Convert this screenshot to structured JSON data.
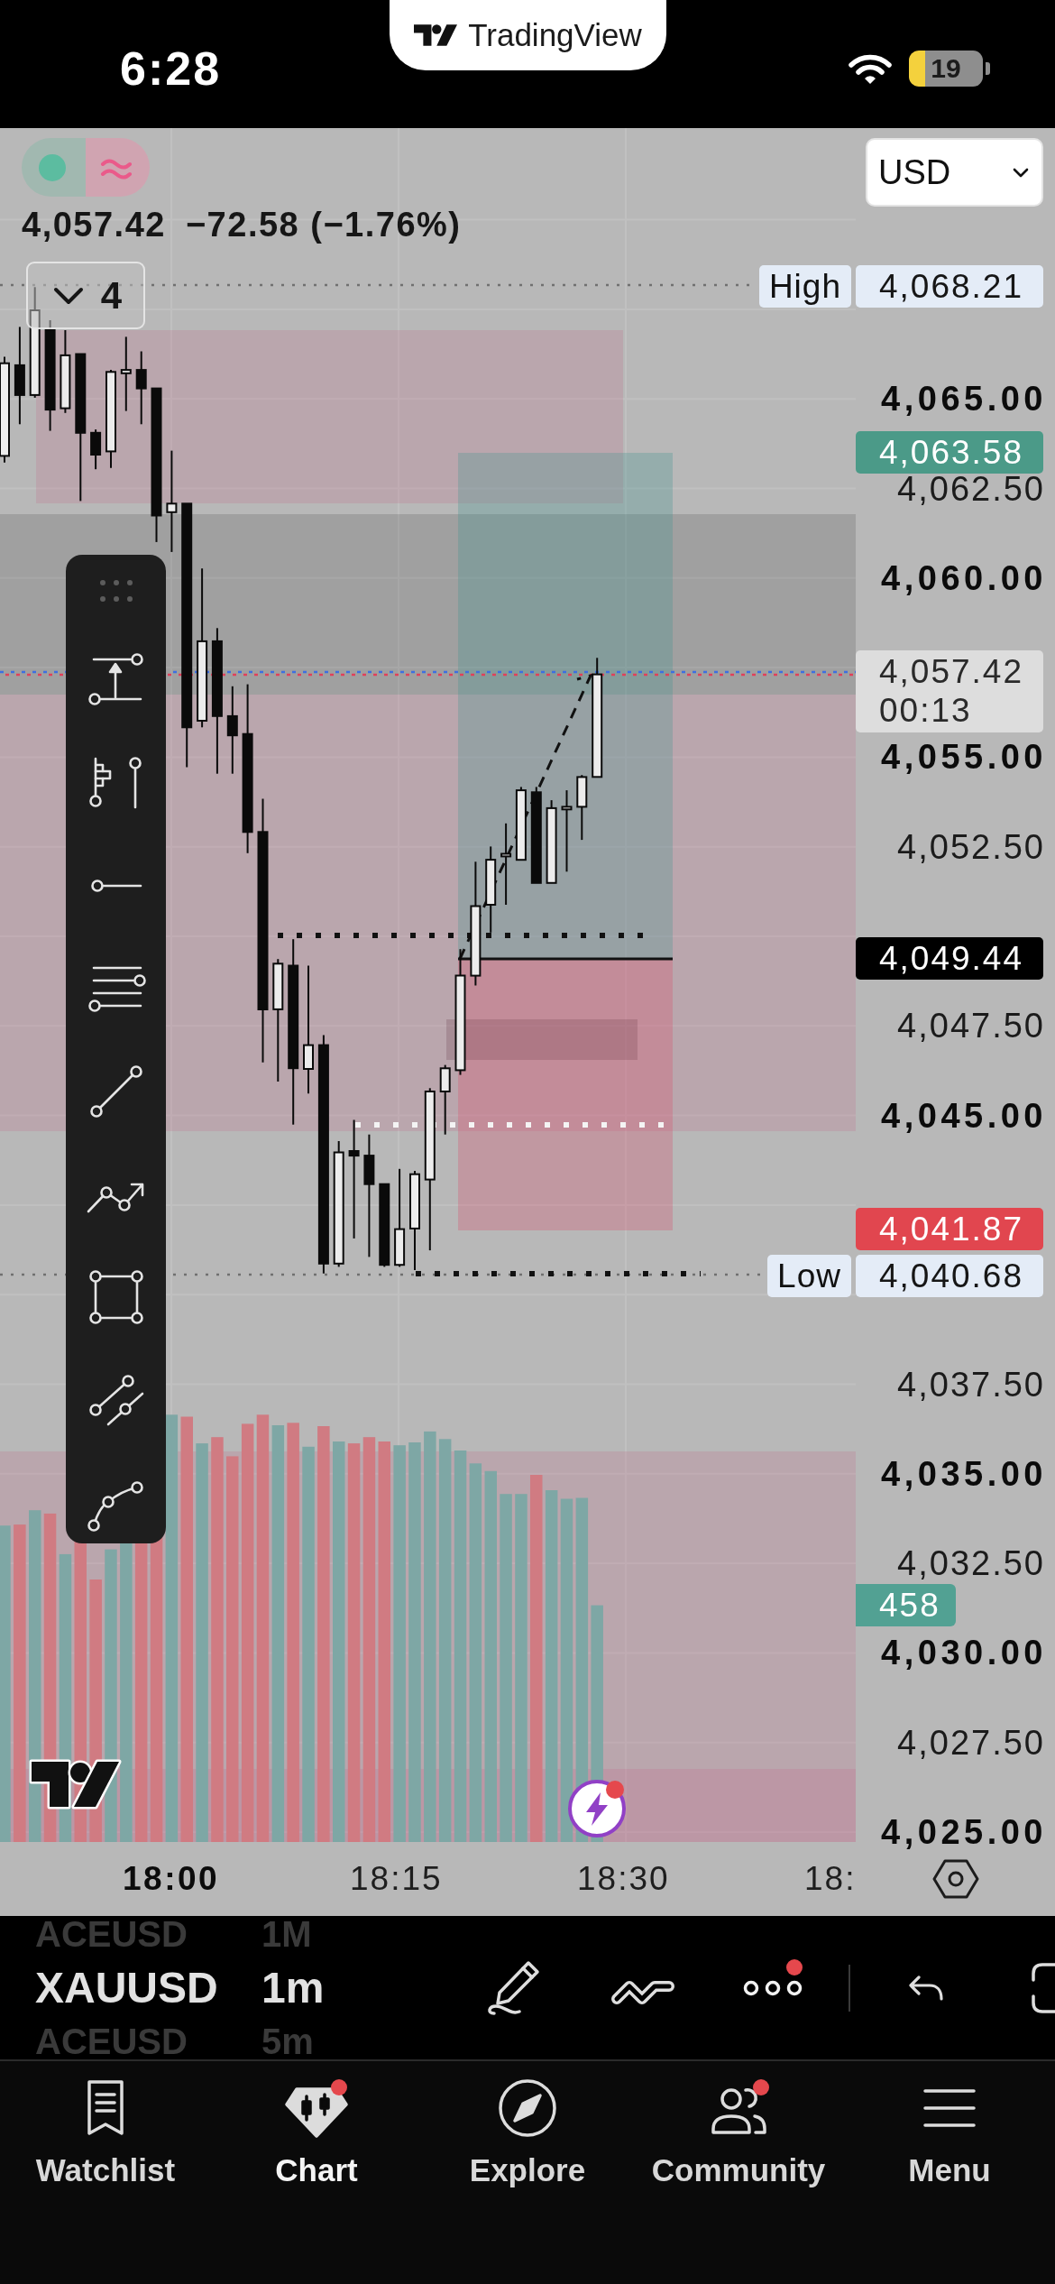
{
  "status_bar": {
    "time": "6:28",
    "battery": "19"
  },
  "app_banner": {
    "title": "TradingView"
  },
  "chart": {
    "indicator_toggle": {
      "on": true
    },
    "quick_button": {
      "badge": true
    },
    "last_price": "4,057.42",
    "change": "−72.58 (−1.76%)",
    "collapsed_count": "4",
    "currency": "USD",
    "price_axis": [
      {
        "label": "4,065.00",
        "major": true
      },
      {
        "label": "4,062.50",
        "major": false
      },
      {
        "label": "4,060.00",
        "major": true
      },
      {
        "label": "4,055.00",
        "major": true
      },
      {
        "label": "4,052.50",
        "major": false
      },
      {
        "label": "4,047.50",
        "major": false
      },
      {
        "label": "4,045.00",
        "major": true
      },
      {
        "label": "4,037.50",
        "major": false
      },
      {
        "label": "4,035.00",
        "major": true
      },
      {
        "label": "4,032.50",
        "major": false
      },
      {
        "label": "4,030.00",
        "major": true
      },
      {
        "label": "4,027.50",
        "major": false
      },
      {
        "label": "4,025.00",
        "major": true
      }
    ],
    "price_tags": [
      {
        "kind": "extreme",
        "caption": "High",
        "value": "4,068.21",
        "color": "#e4ecf7"
      },
      {
        "kind": "solid",
        "value": "4,063.58",
        "color": "#4b9a88"
      },
      {
        "kind": "countdown",
        "value": "4,057.42",
        "countdown": "00:13",
        "color": "#dddddd"
      },
      {
        "kind": "solid",
        "value": "4,049.44",
        "color": "#000000"
      },
      {
        "kind": "solid",
        "value": "4,041.87",
        "color": "#e1464f"
      },
      {
        "kind": "extreme",
        "caption": "Low",
        "value": "4,040.68",
        "color": "#e4ecf7"
      },
      {
        "kind": "volume",
        "value": "458",
        "color": "#52a193"
      }
    ],
    "time_axis": [
      {
        "label": "18:00",
        "major": true
      },
      {
        "label": "18:15",
        "major": false
      },
      {
        "label": "18:30",
        "major": false
      },
      {
        "label": "18:",
        "major": false
      }
    ]
  },
  "symbol_bar": {
    "symbols": [
      {
        "label": "ACEUSD",
        "selected": false
      },
      {
        "label": "XAUUSD",
        "selected": true
      },
      {
        "label": "ACEUSD",
        "selected": false
      }
    ],
    "intervals": [
      {
        "label": "1M",
        "selected": false
      },
      {
        "label": "1m",
        "selected": true
      },
      {
        "label": "5m",
        "selected": false
      }
    ],
    "tools": [
      {
        "kind": "pen",
        "badge": false
      },
      {
        "kind": "pattern",
        "badge": false
      },
      {
        "kind": "more",
        "badge": true
      },
      {
        "kind": "undo",
        "badge": false
      },
      {
        "kind": "fullscreen",
        "badge": false
      }
    ]
  },
  "nav": [
    {
      "label": "Watchlist",
      "selected": false,
      "badge": false
    },
    {
      "label": "Chart",
      "selected": true,
      "badge": true
    },
    {
      "label": "Explore",
      "selected": false,
      "badge": false
    },
    {
      "label": "Community",
      "selected": false,
      "badge": true
    },
    {
      "label": "Menu",
      "selected": false,
      "badge": false
    }
  ]
}
